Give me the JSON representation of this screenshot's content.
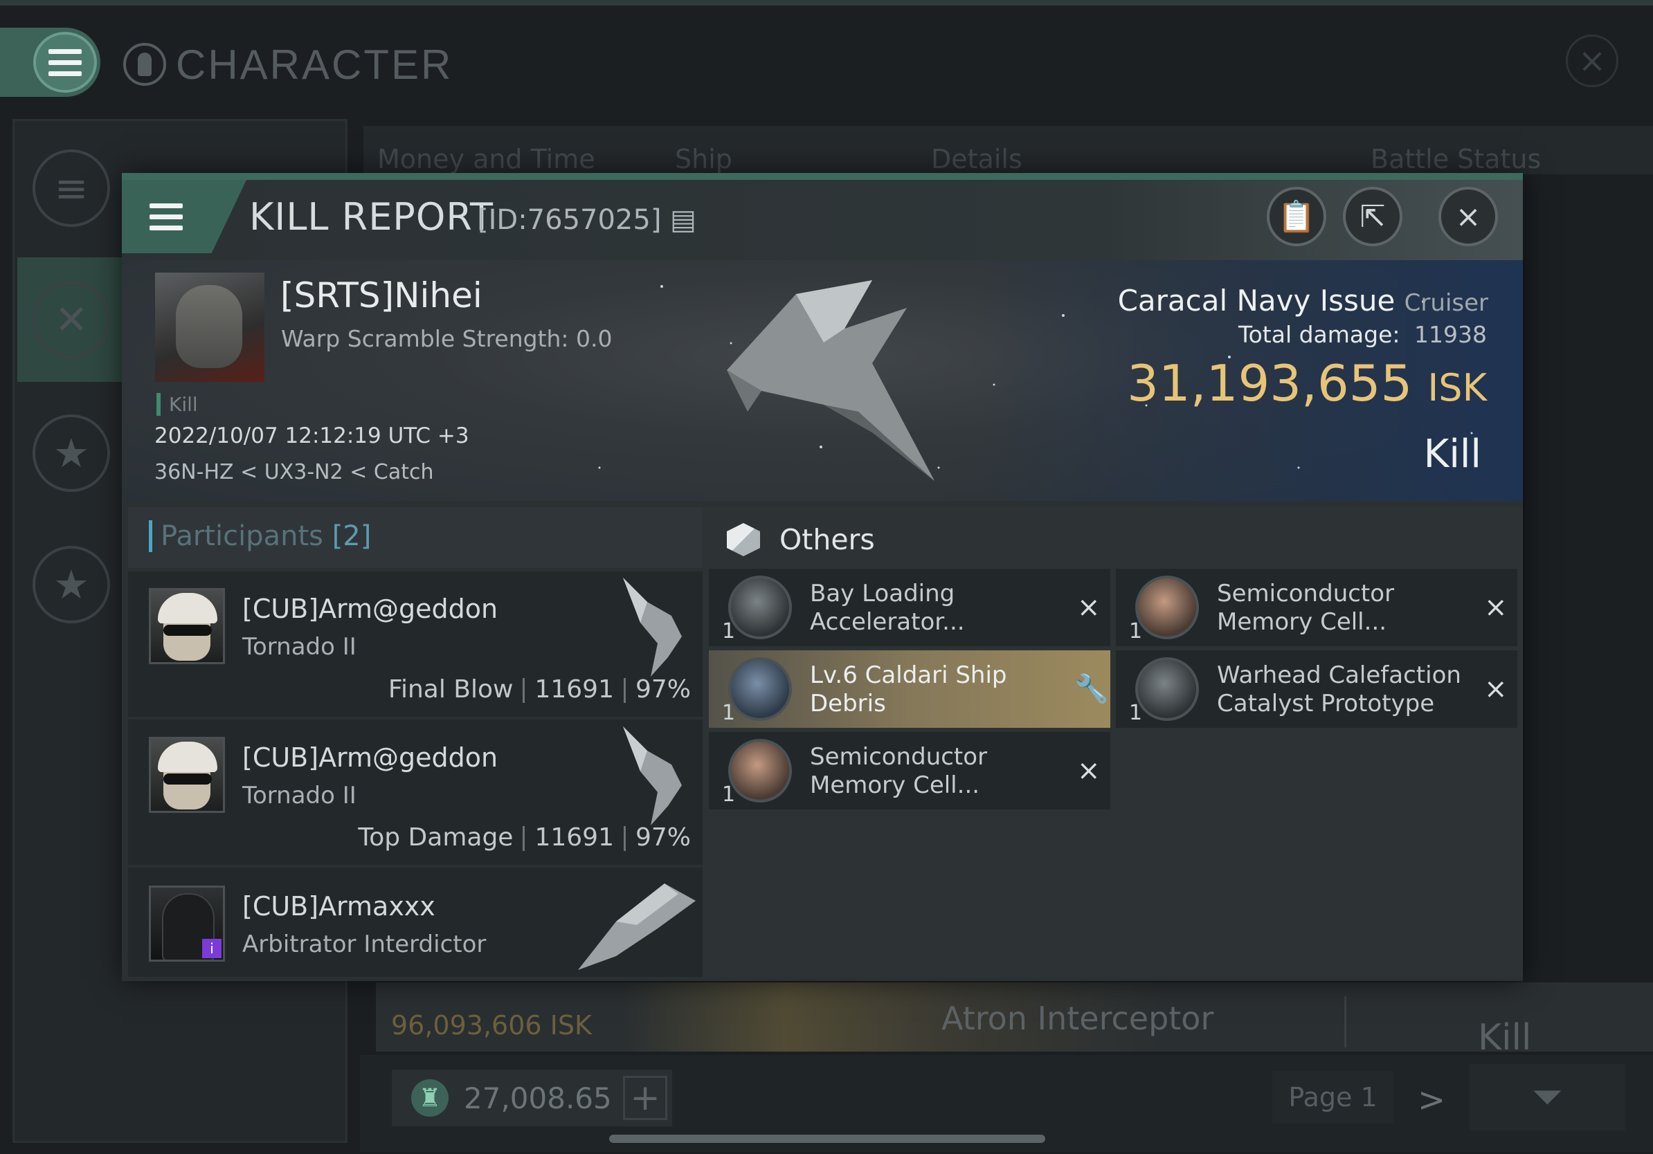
{
  "background": {
    "screen_title": "CHARACTER",
    "tabs": [
      "Money and Time",
      "Ship",
      "Details",
      "Battle Status"
    ],
    "list_row": {
      "isk": "96,093,606",
      "isk_unit": "ISK",
      "ship": "Atron Interceptor",
      "result": "Kill"
    },
    "wallet": {
      "value": "27,008.65",
      "add": "+"
    },
    "pager": {
      "label": "Page 1",
      "next": ">"
    }
  },
  "kill_report": {
    "title": "KILL REPORT",
    "id_label": "[ID:7657025]",
    "victim": {
      "name": "[SRTS]Nihei",
      "warp_scramble": "Warp Scramble Strength: 0.0",
      "tag": "Kill",
      "datetime": "2022/10/07 12:12:19 UTC +3",
      "location": "36N-HZ < UX3-N2 < Catch"
    },
    "ship": {
      "name": "Caracal Navy Issue",
      "class": "Cruiser",
      "total_damage_label": "Total damage:",
      "total_damage": "11938",
      "isk_value": "31,193,655",
      "isk_unit": "ISK",
      "result": "Kill"
    },
    "participants": {
      "label": "Participants",
      "count": "[2]",
      "rows": [
        {
          "name": "[CUB]Arm@geddon",
          "ship": "Tornado II",
          "role": "Final Blow",
          "damage": "11691",
          "percent": "97%"
        },
        {
          "name": "[CUB]Arm@geddon",
          "ship": "Tornado II",
          "role": "Top Damage",
          "damage": "11691",
          "percent": "97%"
        },
        {
          "name": "[CUB]Armaxxx",
          "ship": "Arbitrator Interdictor"
        }
      ]
    },
    "others": {
      "label": "Others",
      "items": [
        {
          "qty": "1",
          "line1": "Bay Loading",
          "line2": "Accelerator...",
          "icon": "module-icon",
          "action": "×"
        },
        {
          "qty": "1",
          "line1": "Semiconductor",
          "line2": "Memory Cell...",
          "icon": "cell-icon",
          "action": "×"
        },
        {
          "qty": "1",
          "line1": "Lv.6 Caldari Ship",
          "line2": "Debris",
          "icon": "debris-icon",
          "action": "wrench"
        },
        {
          "qty": "1",
          "line1": "Warhead Calefaction",
          "line2": "Catalyst Prototype",
          "icon": "module-icon",
          "action": "×"
        },
        {
          "qty": "1",
          "line1": "Semiconductor",
          "line2": "Memory Cell...",
          "icon": "cell-icon",
          "action": "×"
        }
      ]
    },
    "colors": {
      "accent": "#3d6a5d",
      "isk": "#e8c477",
      "highlight": "#857859"
    }
  }
}
